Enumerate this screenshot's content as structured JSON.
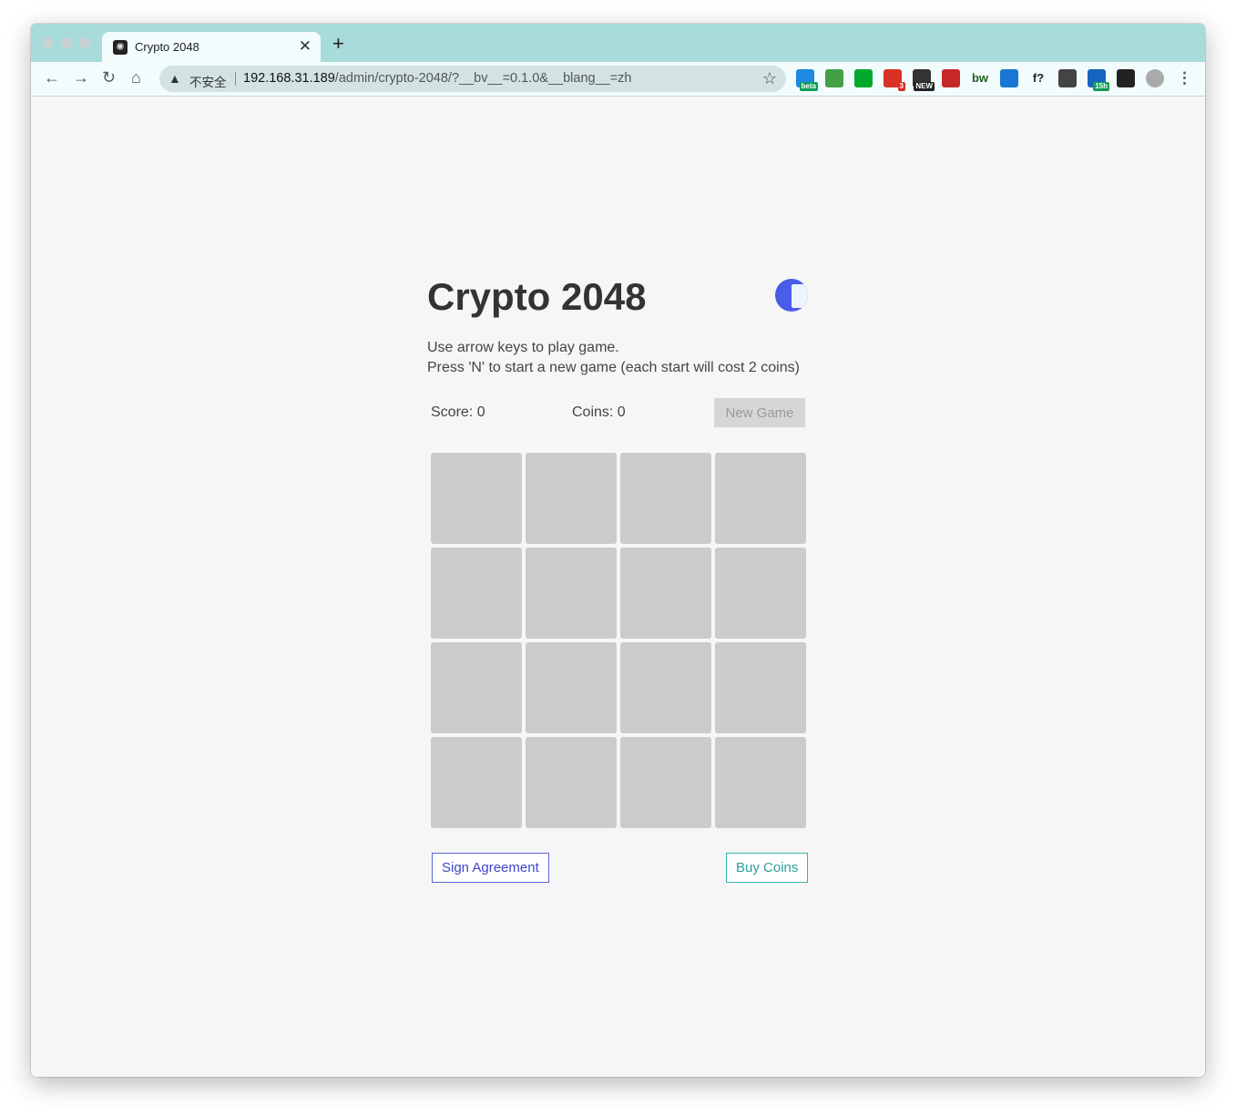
{
  "browser": {
    "tab_title": "Crypto 2048",
    "new_tab_symbol": "+",
    "address": {
      "security_label": "不安全",
      "host": "192.168.31.189",
      "path": "/admin/crypto-2048/?__bv__=0.1.0&__blang__=zh"
    },
    "extensions": [
      {
        "name": "beta-extension-icon",
        "badge": "beta",
        "color": "#1e88e5"
      },
      {
        "name": "sheets-extension-icon",
        "badge": "",
        "color": "#43a047"
      },
      {
        "name": "evernote-extension-icon",
        "badge": "",
        "color": "#00a82d"
      },
      {
        "name": "gmail-extension-icon",
        "badge": "3",
        "color": "#d93025"
      },
      {
        "name": "news-extension-icon",
        "badge": "NEW",
        "color": "#333333"
      },
      {
        "name": "s-extension-icon",
        "badge": "",
        "color": "#c62828"
      },
      {
        "name": "bw-extension-icon",
        "label": "bw",
        "color": "#1b5e20"
      },
      {
        "name": "screen-extension-icon",
        "badge": "",
        "color": "#1976d2"
      },
      {
        "name": "formula-extension-icon",
        "label": "f?",
        "color": "#222222"
      },
      {
        "name": "translate-extension-icon",
        "badge": "",
        "color": "#444444"
      },
      {
        "name": "timer-extension-icon",
        "badge": "15h",
        "color": "#1565c0"
      },
      {
        "name": "puzzle-extension-icon",
        "badge": "",
        "color": "#222222"
      },
      {
        "name": "profile-avatar-icon",
        "badge": "",
        "color": "#aaaaaa"
      }
    ]
  },
  "game": {
    "title": "Crypto 2048",
    "instructions_line1": "Use arrow keys to play game.",
    "instructions_line2": "Press 'N' to start a new game (each start will cost 2 coins)",
    "score_text": "Score: 0",
    "coins_text": "Coins: 0",
    "new_game_label": "New Game",
    "grid_size": 4,
    "sign_agreement_label": "Sign Agreement",
    "buy_coins_label": "Buy Coins"
  }
}
